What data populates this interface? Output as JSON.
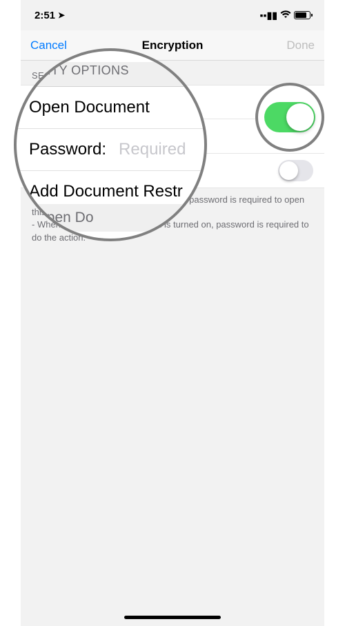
{
  "statusbar": {
    "time": "2:51"
  },
  "navbar": {
    "cancel": "Cancel",
    "title": "Encryption",
    "done": "Done"
  },
  "section_header": "SECURITY OPTIONS",
  "rows": {
    "open_doc": {
      "label": "Open Document",
      "on": true
    },
    "restrictions": {
      "label": "Add Document Restrictions",
      "on": false
    }
  },
  "footer": {
    "line1": "- When \"Open Document\" is turned on, password is required to open this document.",
    "line2": "- When \"Open Document\" option is turned on, password is required to do the action."
  },
  "magnifier": {
    "sec_hdr": "JRITY OPTIONS",
    "row1_label": "Open Document",
    "row2_label": "Password:",
    "row2_placeholder": "Required",
    "row3_label": "Add Document Restr",
    "last": "\"Open Do"
  }
}
